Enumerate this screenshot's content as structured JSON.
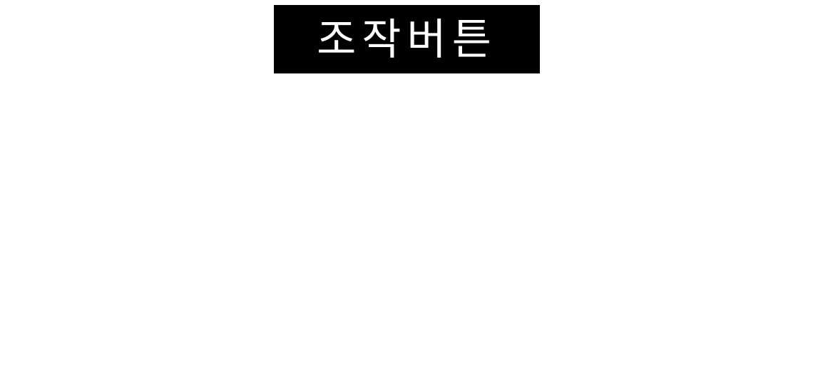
{
  "header": {
    "title": "조작버튼"
  },
  "colors": {
    "background": "#ffffff",
    "banner_background": "#000000",
    "banner_text": "#ffffff"
  }
}
